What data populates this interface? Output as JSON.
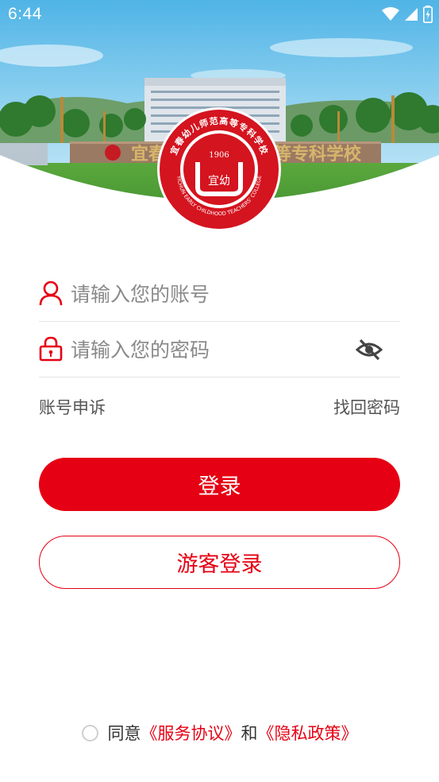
{
  "status_bar": {
    "time": "6:44",
    "icons": [
      "wifi-icon",
      "cellular-signal-icon",
      "battery-charging-icon"
    ]
  },
  "hero": {
    "banner_text": "宜春幼儿师范高等专科学校",
    "emblem": {
      "year": "1906",
      "arc_cn": "宜春幼儿师范高等专科学校",
      "arc_en": "YICHUN EARLY CHILDHOOD TEACHERS' COLLEGE",
      "center_glyph": "宜幼"
    }
  },
  "form": {
    "account_placeholder": "请输入您的账号",
    "password_placeholder": "请输入您的密码",
    "account_appeal": "账号申诉",
    "find_password": "找回密码"
  },
  "buttons": {
    "login": "登录",
    "guest_login": "游客登录"
  },
  "agreement": {
    "agree": "同意",
    "service": "《服务协议》",
    "and": "和",
    "privacy": "《隐私政策》"
  },
  "colors": {
    "brand_red": "#e60013",
    "grass_green": "#4e9a3a"
  }
}
